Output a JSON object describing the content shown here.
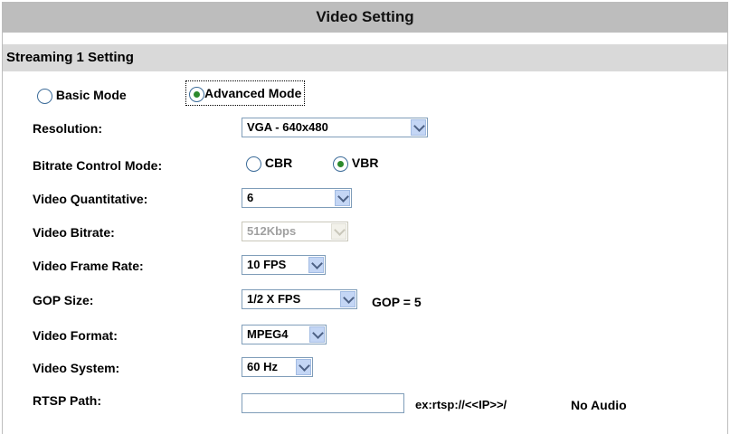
{
  "page": {
    "title": "Video Setting"
  },
  "section": {
    "title": "Streaming 1 Setting"
  },
  "mode": {
    "basic_label": "Basic Mode",
    "advanced_label": "Advanced Mode",
    "selected": "advanced"
  },
  "resolution": {
    "label": "Resolution:",
    "value": "VGA - 640x480"
  },
  "bitrate_control": {
    "label": "Bitrate Control Mode:",
    "cbr_label": "CBR",
    "vbr_label": "VBR",
    "selected": "VBR"
  },
  "quantitative": {
    "label": "Video Quantitative:",
    "value": "6"
  },
  "bitrate": {
    "label": "Video Bitrate:",
    "value": "512Kbps",
    "disabled": true
  },
  "frame_rate": {
    "label": "Video Frame Rate:",
    "value": "10 FPS"
  },
  "gop": {
    "label": "GOP Size:",
    "value": "1/2 X FPS",
    "readout": "GOP = 5"
  },
  "format": {
    "label": "Video Format:",
    "value": "MPEG4"
  },
  "system": {
    "label": "Video System:",
    "value": "60 Hz"
  },
  "rtsp": {
    "label": "RTSP Path:",
    "value": "",
    "example": "ex:rtsp://<<IP>>/",
    "audio_note": "No Audio"
  }
}
